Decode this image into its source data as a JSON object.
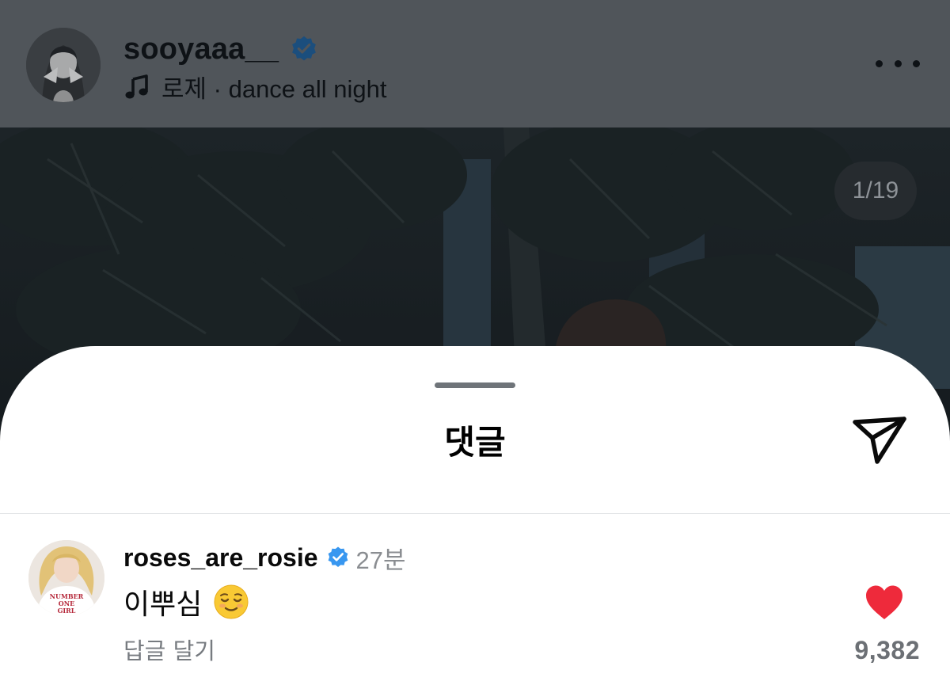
{
  "post": {
    "username": "sooyaaa__",
    "music": "로제 · dance all night",
    "page_indicator": "1/19"
  },
  "sheet": {
    "title": "댓글"
  },
  "comment": {
    "username": "roses_are_rosie",
    "time": "27분",
    "text": "이뿌심",
    "emoji": "relieved-face",
    "reply_label": "답글 달기",
    "like_count": "9,382",
    "avatar_shirt_text": [
      "NUMBER",
      "ONE",
      "GIRL"
    ]
  },
  "icons": {
    "verified": "verified-badge-icon",
    "music": "music-note-icon",
    "more": "more-horizontal-icon",
    "share": "paper-plane-icon",
    "like": "heart-icon"
  },
  "colors": {
    "verified_blue": "#3897f0",
    "heart_red": "#ee2a3b",
    "header_dim": "#50555a"
  }
}
